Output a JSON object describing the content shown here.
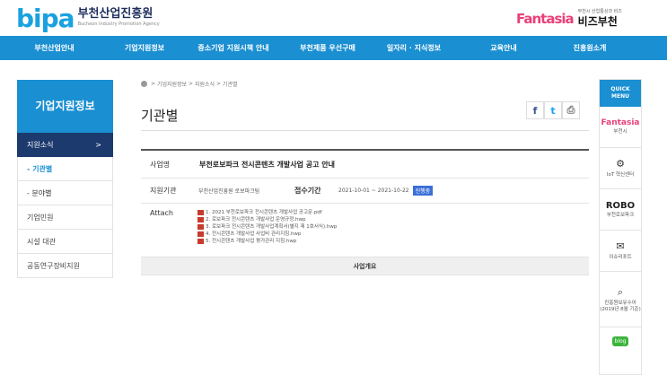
{
  "header": {
    "logo_mark": "bipa",
    "logo_kor": "부천산업진흥원",
    "logo_eng": "Bucheon Industry Promotion Agency",
    "right_brand": "Fantasia",
    "right_small": "부천시 산업통상과 비즈",
    "right_big": "비즈부천"
  },
  "nav": [
    "부천산업안내",
    "기업지원정보",
    "중소기업 지원시책 안내",
    "부천제품 우선구매",
    "일자리 · 지식정보",
    "교육안내",
    "진흥원소개"
  ],
  "sidebar": {
    "title": "기업지원정보",
    "items": [
      {
        "label": "지원소식",
        "arrow": ">"
      },
      {
        "label": "- 기관별"
      },
      {
        "label": "- 분야별"
      },
      {
        "label": "기업민원"
      },
      {
        "label": "시설 대관"
      },
      {
        "label": "공동연구장비지원"
      }
    ]
  },
  "breadcrumb": {
    "sep": ">",
    "items": [
      "기업지원정보",
      "지원소식",
      "기관별"
    ]
  },
  "page": {
    "title": "기관별"
  },
  "share": {
    "facebook": "f",
    "twitter": "t",
    "print": "⎙"
  },
  "post": {
    "subject_label": "사업명",
    "subject": "부천로보파크 전시콘텐츠 개발사업 공고 안내",
    "org_label": "지원기관",
    "org": "부천산업진흥원 로보파크팀",
    "period_label": "접수기간",
    "period": "2021-10-01 ~ 2021-10-22",
    "status": "진행중",
    "attach_label": "Attach",
    "files": [
      "1. 2021 부천로보파크 전시콘텐츠 개발사업 공고문.pdf",
      "2. 로보파크 전시콘텐츠 개발사업 운영규정.hwp",
      "3. 로보파크 전시콘텐츠 개발사업계획서(별지 제 1호서식).hwp",
      "4. 전시콘텐츠 개발사업 사업비 관리지침.hwp",
      "5. 전시콘텐츠 개발사업 평가관리 지침.hwp"
    ],
    "overview": "사업개요"
  },
  "quick": {
    "head_line1": "QUICK",
    "head_line2": "MENU",
    "items": [
      {
        "icon": "fantasia-icon",
        "glyph": "Fantasia",
        "label": "부천시"
      },
      {
        "icon": "iot-icon",
        "glyph": "⚙",
        "label": "IoT 혁신센터"
      },
      {
        "icon": "robo-icon",
        "glyph": "ROBO",
        "label": "부천로보파크"
      },
      {
        "icon": "mail-icon",
        "glyph": "✉",
        "label": "이슈리포트"
      },
      {
        "icon": "search-icon",
        "glyph": "⌕",
        "label": "진흥원보유수어 (2019년 8월 기준)"
      },
      {
        "icon": "blog-icon",
        "glyph": "blog",
        "label": ""
      }
    ]
  }
}
